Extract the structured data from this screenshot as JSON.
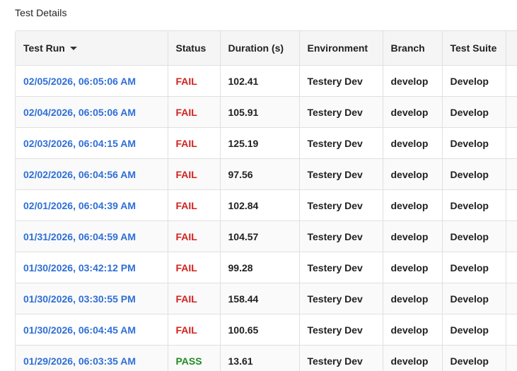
{
  "section": {
    "title": "Test Details"
  },
  "table": {
    "columns": [
      "Test Run",
      "Status",
      "Duration (s)",
      "Environment",
      "Branch",
      "Test Suite"
    ],
    "sorted_column": "Test Run",
    "sort_direction": "descending",
    "status_colors": {
      "FAIL": "#d0231f",
      "PASS": "#228b22"
    },
    "link_color": "#2f6fd6",
    "rows": [
      {
        "run": "02/05/2026, 06:05:06 AM",
        "status": "FAIL",
        "duration": "102.41",
        "environment": "Testery Dev",
        "branch": "develop",
        "suite": "Develop"
      },
      {
        "run": "02/04/2026, 06:05:06 AM",
        "status": "FAIL",
        "duration": "105.91",
        "environment": "Testery Dev",
        "branch": "develop",
        "suite": "Develop"
      },
      {
        "run": "02/03/2026, 06:04:15 AM",
        "status": "FAIL",
        "duration": "125.19",
        "environment": "Testery Dev",
        "branch": "develop",
        "suite": "Develop"
      },
      {
        "run": "02/02/2026, 06:04:56 AM",
        "status": "FAIL",
        "duration": "97.56",
        "environment": "Testery Dev",
        "branch": "develop",
        "suite": "Develop"
      },
      {
        "run": "02/01/2026, 06:04:39 AM",
        "status": "FAIL",
        "duration": "102.84",
        "environment": "Testery Dev",
        "branch": "develop",
        "suite": "Develop"
      },
      {
        "run": "01/31/2026, 06:04:59 AM",
        "status": "FAIL",
        "duration": "104.57",
        "environment": "Testery Dev",
        "branch": "develop",
        "suite": "Develop"
      },
      {
        "run": "01/30/2026, 03:42:12 PM",
        "status": "FAIL",
        "duration": "99.28",
        "environment": "Testery Dev",
        "branch": "develop",
        "suite": "Develop"
      },
      {
        "run": "01/30/2026, 03:30:55 PM",
        "status": "FAIL",
        "duration": "158.44",
        "environment": "Testery Dev",
        "branch": "develop",
        "suite": "Develop"
      },
      {
        "run": "01/30/2026, 06:04:45 AM",
        "status": "FAIL",
        "duration": "100.65",
        "environment": "Testery Dev",
        "branch": "develop",
        "suite": "Develop"
      },
      {
        "run": "01/29/2026, 06:03:35 AM",
        "status": "PASS",
        "duration": "13.61",
        "environment": "Testery Dev",
        "branch": "develop",
        "suite": "Develop"
      }
    ]
  }
}
